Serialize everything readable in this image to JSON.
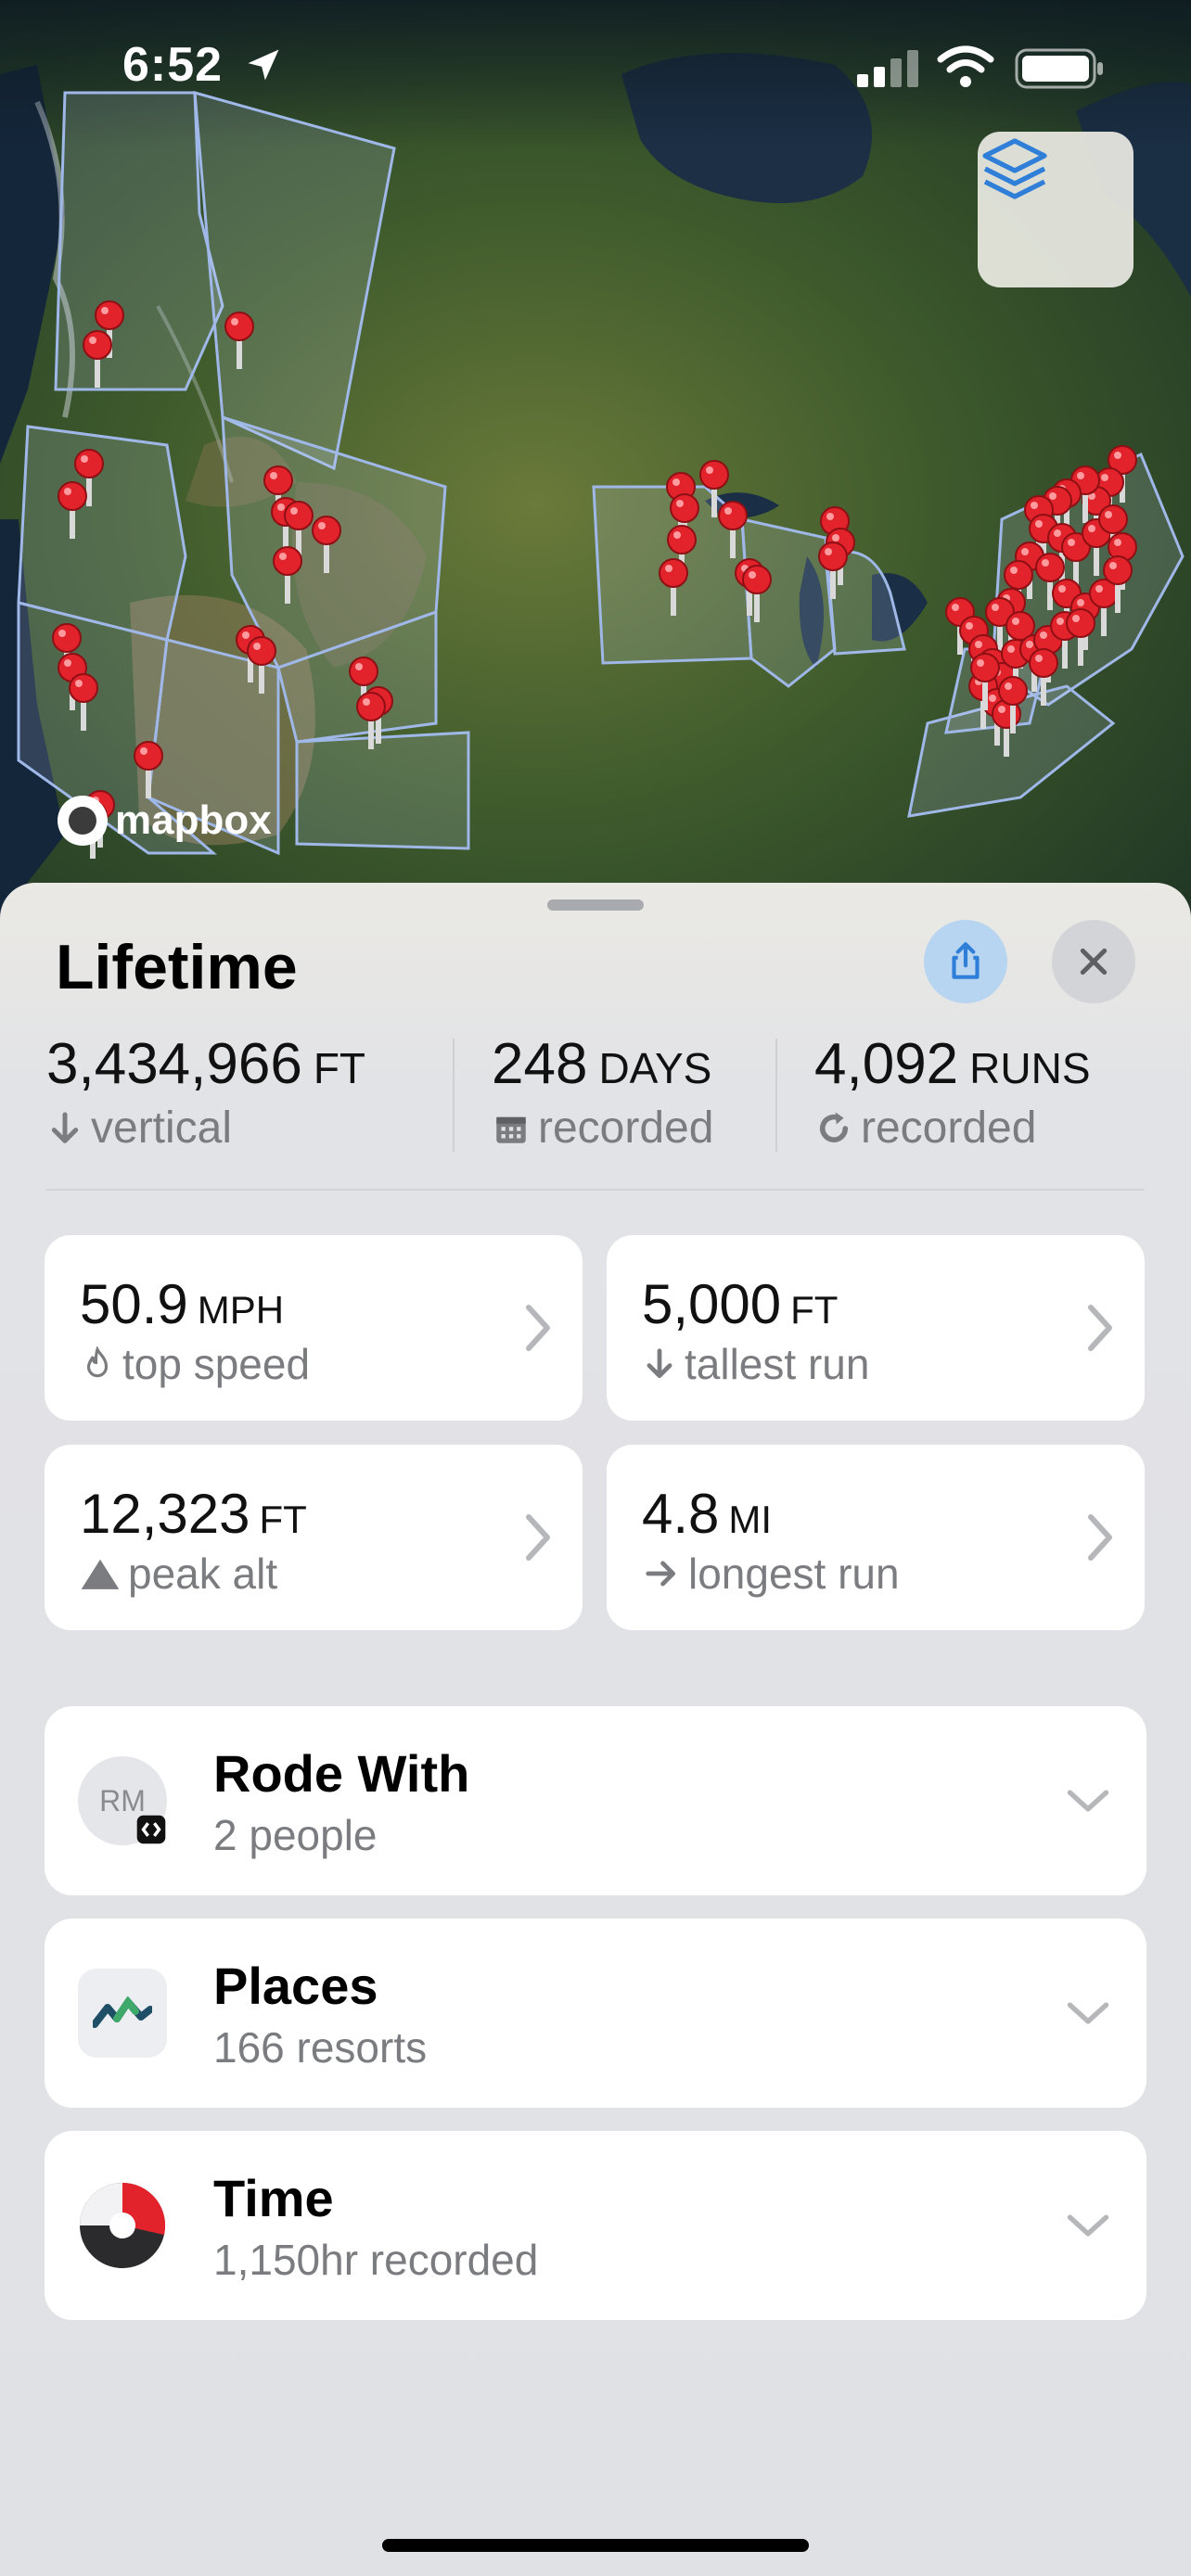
{
  "status_bar": {
    "time": "6:52"
  },
  "map": {
    "attribution": "mapbox"
  },
  "sheet": {
    "title": "Lifetime",
    "stats": [
      {
        "value": "3,434,966",
        "unit": "FT",
        "label": "vertical"
      },
      {
        "value": "248",
        "unit": "DAYS",
        "label": "recorded"
      },
      {
        "value": "4,092",
        "unit": "RUNS",
        "label": "recorded"
      }
    ],
    "cards": [
      {
        "value": "50.9",
        "unit": "MPH",
        "label": "top speed"
      },
      {
        "value": "5,000",
        "unit": "FT",
        "label": "tallest run"
      },
      {
        "value": "12,323",
        "unit": "FT",
        "label": "peak alt"
      },
      {
        "value": "4.8",
        "unit": "MI",
        "label": "longest run"
      }
    ],
    "rows": [
      {
        "title": "Rode With",
        "subtitle": "2 people",
        "avatar_initials": "RM"
      },
      {
        "title": "Places",
        "subtitle": "166 resorts"
      },
      {
        "title": "Time",
        "subtitle": "1,150hr recorded"
      }
    ]
  },
  "colors": {
    "pin": "#e3232b",
    "accent": "#2f7fd8",
    "share_bg": "#b7d4f0",
    "sheet_bg": "#e0e1e5"
  }
}
